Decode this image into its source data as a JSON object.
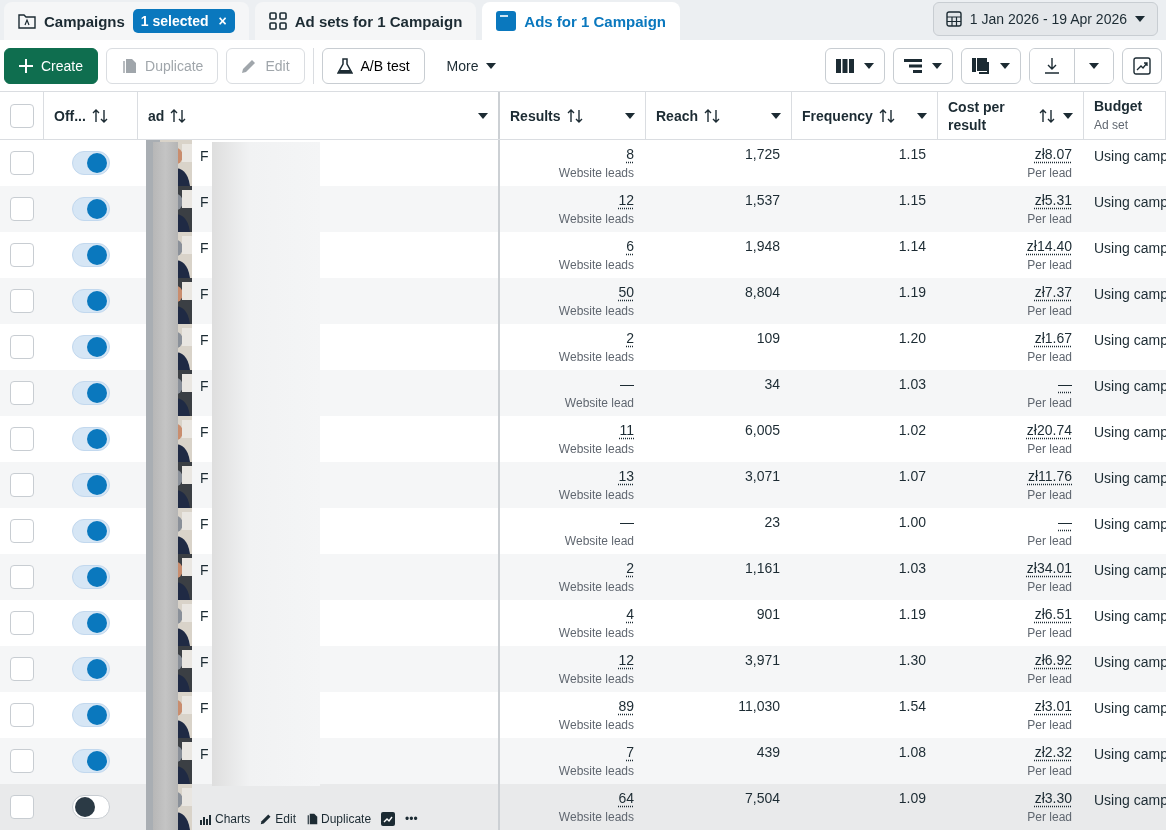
{
  "tabs": [
    {
      "kind": "campaigns",
      "label": "Campaigns",
      "badge": "1 selected",
      "badge_close": "×",
      "selected": false
    },
    {
      "kind": "adsets",
      "label": "Ad sets for 1 Campaign",
      "selected": false
    },
    {
      "kind": "ads",
      "label": "Ads for 1 Campaign",
      "selected": true
    }
  ],
  "date_range": "1 Jan 2026 - 19 Apr 2026",
  "toolbar": [
    {
      "kind": "create",
      "label": "Create",
      "disabled": false
    },
    {
      "kind": "duplicate",
      "label": "Duplicate",
      "disabled": true
    },
    {
      "kind": "edit",
      "label": "Edit",
      "disabled": true
    },
    {
      "kind": "abtest",
      "label": "A/B test",
      "disabled": false
    },
    {
      "kind": "more",
      "label": "More",
      "disabled": false
    }
  ],
  "table": {
    "select_all_checked": false,
    "columns": [
      {
        "label": "Off...",
        "sortable": true,
        "menu": false
      },
      {
        "label": "ad",
        "sortable": true,
        "menu": true
      },
      {
        "label": "Results",
        "sortable": true,
        "menu": true
      },
      {
        "label": "Reach",
        "sortable": true,
        "menu": true
      },
      {
        "label": "Frequency",
        "sortable": true,
        "menu": true
      },
      {
        "label": "Cost per result",
        "sortable": true,
        "menu": true
      },
      {
        "label": "Budget",
        "sub": "Ad set",
        "sortable": false,
        "menu": false
      }
    ],
    "rows": [
      {
        "checked": false,
        "on": true,
        "hovered": false,
        "name": "F",
        "results": "8",
        "results_label": "Website leads",
        "reach": "1,725",
        "frequency": "1.15",
        "cost": "zł8.07",
        "cost_label": "Per lead",
        "budget": "Using camp"
      },
      {
        "checked": false,
        "on": true,
        "hovered": false,
        "name": "F",
        "results": "12",
        "results_label": "Website leads",
        "reach": "1,537",
        "frequency": "1.15",
        "cost": "zł5.31",
        "cost_label": "Per lead",
        "budget": "Using camp"
      },
      {
        "checked": false,
        "on": true,
        "hovered": false,
        "name": "F",
        "results": "6",
        "results_label": "Website leads",
        "reach": "1,948",
        "frequency": "1.14",
        "cost": "zł14.40",
        "cost_label": "Per lead",
        "budget": "Using camp"
      },
      {
        "checked": false,
        "on": true,
        "hovered": false,
        "name": "F",
        "results": "50",
        "results_label": "Website leads",
        "reach": "8,804",
        "frequency": "1.19",
        "cost": "zł7.37",
        "cost_label": "Per lead",
        "budget": "Using camp"
      },
      {
        "checked": false,
        "on": true,
        "hovered": false,
        "name": "F",
        "results": "2",
        "results_label": "Website leads",
        "reach": "109",
        "frequency": "1.20",
        "cost": "zł1.67",
        "cost_label": "Per lead",
        "budget": "Using camp"
      },
      {
        "checked": false,
        "on": true,
        "hovered": false,
        "name": "F",
        "results": "—",
        "results_label": "Website lead",
        "reach": "34",
        "frequency": "1.03",
        "cost": "—",
        "cost_label": "Per lead",
        "budget": "Using camp"
      },
      {
        "checked": false,
        "on": true,
        "hovered": false,
        "name": "F",
        "results": "11",
        "results_label": "Website leads",
        "reach": "6,005",
        "frequency": "1.02",
        "cost": "zł20.74",
        "cost_label": "Per lead",
        "budget": "Using camp"
      },
      {
        "checked": false,
        "on": true,
        "hovered": false,
        "name": "F",
        "results": "13",
        "results_label": "Website leads",
        "reach": "3,071",
        "frequency": "1.07",
        "cost": "zł11.76",
        "cost_label": "Per lead",
        "budget": "Using camp"
      },
      {
        "checked": false,
        "on": true,
        "hovered": false,
        "name": "F",
        "results": "—",
        "results_label": "Website lead",
        "reach": "23",
        "frequency": "1.00",
        "cost": "—",
        "cost_label": "Per lead",
        "budget": "Using camp"
      },
      {
        "checked": false,
        "on": true,
        "hovered": false,
        "name": "F",
        "results": "2",
        "results_label": "Website leads",
        "reach": "1,161",
        "frequency": "1.03",
        "cost": "zł34.01",
        "cost_label": "Per lead",
        "budget": "Using camp"
      },
      {
        "checked": false,
        "on": true,
        "hovered": false,
        "name": "F",
        "results": "4",
        "results_label": "Website leads",
        "reach": "901",
        "frequency": "1.19",
        "cost": "zł6.51",
        "cost_label": "Per lead",
        "budget": "Using camp"
      },
      {
        "checked": false,
        "on": true,
        "hovered": false,
        "name": "F",
        "results": "12",
        "results_label": "Website leads",
        "reach": "3,971",
        "frequency": "1.30",
        "cost": "zł6.92",
        "cost_label": "Per lead",
        "budget": "Using camp"
      },
      {
        "checked": false,
        "on": true,
        "hovered": false,
        "name": "F",
        "results": "89",
        "results_label": "Website leads",
        "reach": "11,030",
        "frequency": "1.54",
        "cost": "zł3.01",
        "cost_label": "Per lead",
        "budget": "Using camp"
      },
      {
        "checked": false,
        "on": true,
        "hovered": false,
        "name": "F",
        "results": "7",
        "results_label": "Website leads",
        "reach": "439",
        "frequency": "1.08",
        "cost": "zł2.32",
        "cost_label": "Per lead",
        "budget": "Using camp"
      },
      {
        "checked": false,
        "on": false,
        "hovered": true,
        "results": "64",
        "results_label": "Website leads",
        "reach": "7,504",
        "frequency": "1.09",
        "cost": "zł3.30",
        "cost_label": "Per lead",
        "budget": "Using camp",
        "actions": [
          {
            "kind": "charts",
            "label": "Charts"
          },
          {
            "kind": "edit",
            "label": "Edit"
          },
          {
            "kind": "duplicate",
            "label": "Duplicate"
          },
          {
            "kind": "trend"
          },
          {
            "kind": "more",
            "label": "•••"
          }
        ]
      }
    ]
  }
}
